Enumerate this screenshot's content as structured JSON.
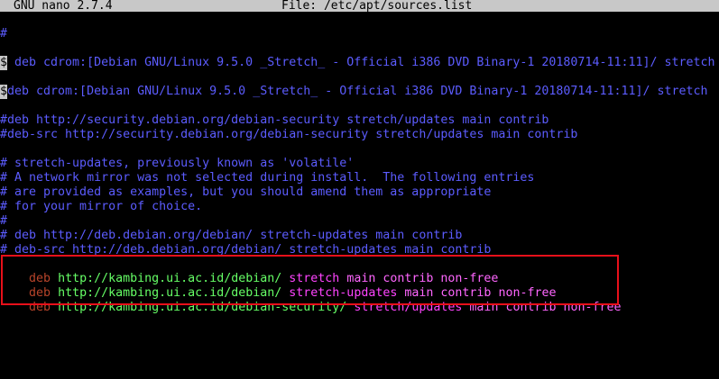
{
  "title_bar": {
    "app_version": "GNU nano 2.7.4",
    "file_label": "File: /etc/apt/sources.list"
  },
  "lines": {
    "l0": "#",
    "l1": "# deb cdrom:[Debian GNU/Linux 9.5.0 _Stretch_ - Official i386 DVD Binary-1 20180714-11:11]/ stretch",
    "l1_marker": "$",
    "l2": "#deb cdrom:[Debian GNU/Linux 9.5.0 _Stretch_ - Official i386 DVD Binary-1 20180714-11:11]/ stretch",
    "l2_marker": "$",
    "l3": "#deb http://security.debian.org/debian-security stretch/updates main contrib",
    "l4": "#deb-src http://security.debian.org/debian-security stretch/updates main contrib",
    "l5": "# stretch-updates, previously known as 'volatile'",
    "l6": "# A network mirror was not selected during install.  The following entries",
    "l7": "# are provided as examples, but you should amend them as appropriate",
    "l8": "# for your mirror of choice.",
    "l9": "#",
    "l10": "# deb http://deb.debian.org/debian/ stretch-updates main contrib",
    "l11": "# deb-src http://deb.debian.org/debian/ stretch-updates main contrib"
  },
  "sources": [
    {
      "type": "deb",
      "url": "http://kambing.ui.ac.id/debian/",
      "suite": "stretch",
      "components": "main contrib non-free"
    },
    {
      "type": "deb",
      "url": "http://kambing.ui.ac.id/debian/",
      "suite": "stretch-updates",
      "components": "main contrib non-free"
    },
    {
      "type": "deb",
      "url": "http://kambing.ui.ac.id/debian-security/",
      "suite": "stretch/updates",
      "components": "main contrib non-free"
    }
  ],
  "colors": {
    "title_bar_bg": "#c8c8c8",
    "comment": "#5c5cff",
    "deb_keyword": "#b8442a",
    "url": "#66ff66",
    "suite": "#ff44ff",
    "highlight_border": "#e8101a"
  }
}
